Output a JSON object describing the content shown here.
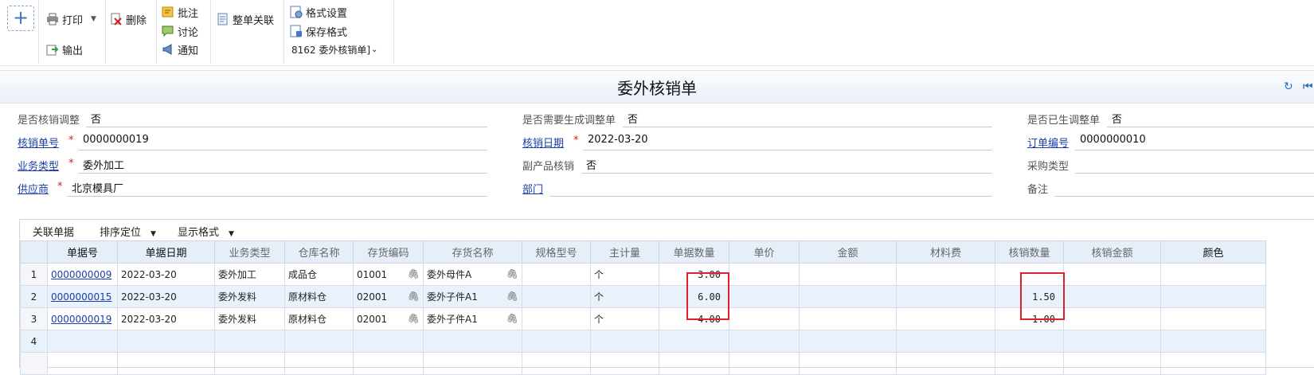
{
  "toolbar": {
    "add": "+",
    "print": "打印",
    "delete": "删除",
    "export": "输出",
    "annotate": "批注",
    "discuss": "讨论",
    "notify": "通知",
    "link_all": "整单关联",
    "format_settings": "格式设置",
    "save_format": "保存格式",
    "format_select": "8162 委外核销单]",
    "icons": [
      "printer-icon",
      "delete-icon",
      "export-icon",
      "note-icon",
      "chat-icon",
      "megaphone-icon",
      "link-icon",
      "format-icon",
      "save-format-icon"
    ]
  },
  "title": "委外核销单",
  "header": {
    "row1": [
      {
        "label": "是否核销调整",
        "value": "否"
      },
      {
        "label": "是否需要生成调整单",
        "value": "否"
      },
      {
        "label": "是否已生调整单",
        "value": "否"
      }
    ],
    "row2": [
      {
        "label": "核销单号",
        "value": "0000000019",
        "required": "*"
      },
      {
        "label": "核销日期",
        "value": "2022-03-20",
        "required": "*"
      },
      {
        "label": "订单编号",
        "value": "0000000010"
      }
    ],
    "row3": [
      {
        "label": "业务类型",
        "value": "委外加工",
        "required": "*"
      },
      {
        "label": "副产品核销",
        "value": "否"
      },
      {
        "label": "采购类型",
        "value": ""
      }
    ],
    "row4": [
      {
        "label": "供应商",
        "value": "北京模具厂",
        "required": "*"
      },
      {
        "label": "部门",
        "value": ""
      },
      {
        "label": "备注",
        "value": ""
      }
    ]
  },
  "grid": {
    "tools": {
      "link_docs": "关联单据",
      "sort_locate": "排序定位",
      "display_format": "显示格式"
    },
    "columns": [
      "单据号",
      "单据日期",
      "业务类型",
      "仓库名称",
      "存货编码",
      "存货名称",
      "规格型号",
      "主计量",
      "单据数量",
      "单价",
      "金额",
      "材料费",
      "核销数量",
      "核销金额",
      "颜色"
    ],
    "rows": [
      {
        "no": "1",
        "doc": "0000000009",
        "date": "2022-03-20",
        "biz": "委外加工",
        "wh": "成品仓",
        "code": "01001",
        "name": "委外母件A",
        "spec": "",
        "unit": "个",
        "qty": "3.00",
        "price": "",
        "amount": "",
        "material": "",
        "wo_qty": "",
        "wo_amount": "",
        "color": ""
      },
      {
        "no": "2",
        "doc": "0000000015",
        "date": "2022-03-20",
        "biz": "委外发料",
        "wh": "原材料仓",
        "code": "02001",
        "name": "委外子件A1",
        "spec": "",
        "unit": "个",
        "qty": "6.00",
        "price": "",
        "amount": "",
        "material": "",
        "wo_qty": "1.50",
        "wo_amount": "",
        "color": ""
      },
      {
        "no": "3",
        "doc": "0000000019",
        "date": "2022-03-20",
        "biz": "委外发料",
        "wh": "原材料仓",
        "code": "02001",
        "name": "委外子件A1",
        "spec": "",
        "unit": "个",
        "qty": "4.00",
        "price": "",
        "amount": "",
        "material": "",
        "wo_qty": "1.00",
        "wo_amount": "",
        "color": ""
      },
      {
        "no": "4"
      }
    ]
  },
  "colors": {
    "accent": "#1b3fa8",
    "required": "#d62020",
    "highlight_box": "#e0202a",
    "header_bg": "#e6eef8"
  }
}
